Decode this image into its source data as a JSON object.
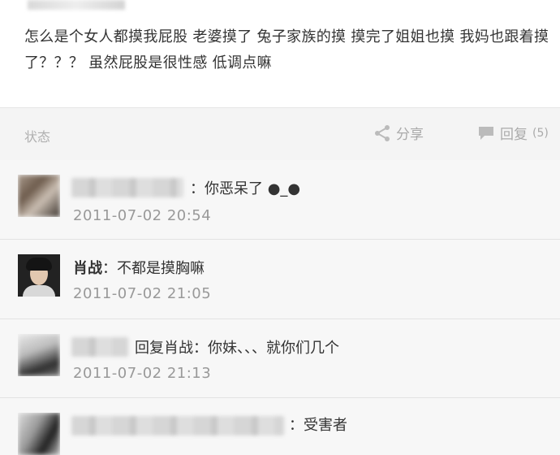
{
  "post": {
    "text": "怎么是个女人都摸我屁股 老婆摸了 兔子家族的摸 摸完了姐姐也摸 我妈也跟着摸了？？？ 虽然屁股是很性感 低调点嘛"
  },
  "actions": {
    "status_label": "状态",
    "share_label": "分享",
    "reply_label": "回复",
    "reply_count": "(5)"
  },
  "comments": [
    {
      "author": "",
      "text": "：你恶呆了 ●_●",
      "time": "2011-07-02 20:54"
    },
    {
      "author": "肖战",
      "text": "：不都是摸胸嘛",
      "time": "2011-07-02 21:05"
    },
    {
      "author": "",
      "text": "回复肖战：你妹、、、就你们几个",
      "time": "2011-07-02 21:13"
    },
    {
      "author": "",
      "text": "：受害者",
      "time": ""
    }
  ]
}
